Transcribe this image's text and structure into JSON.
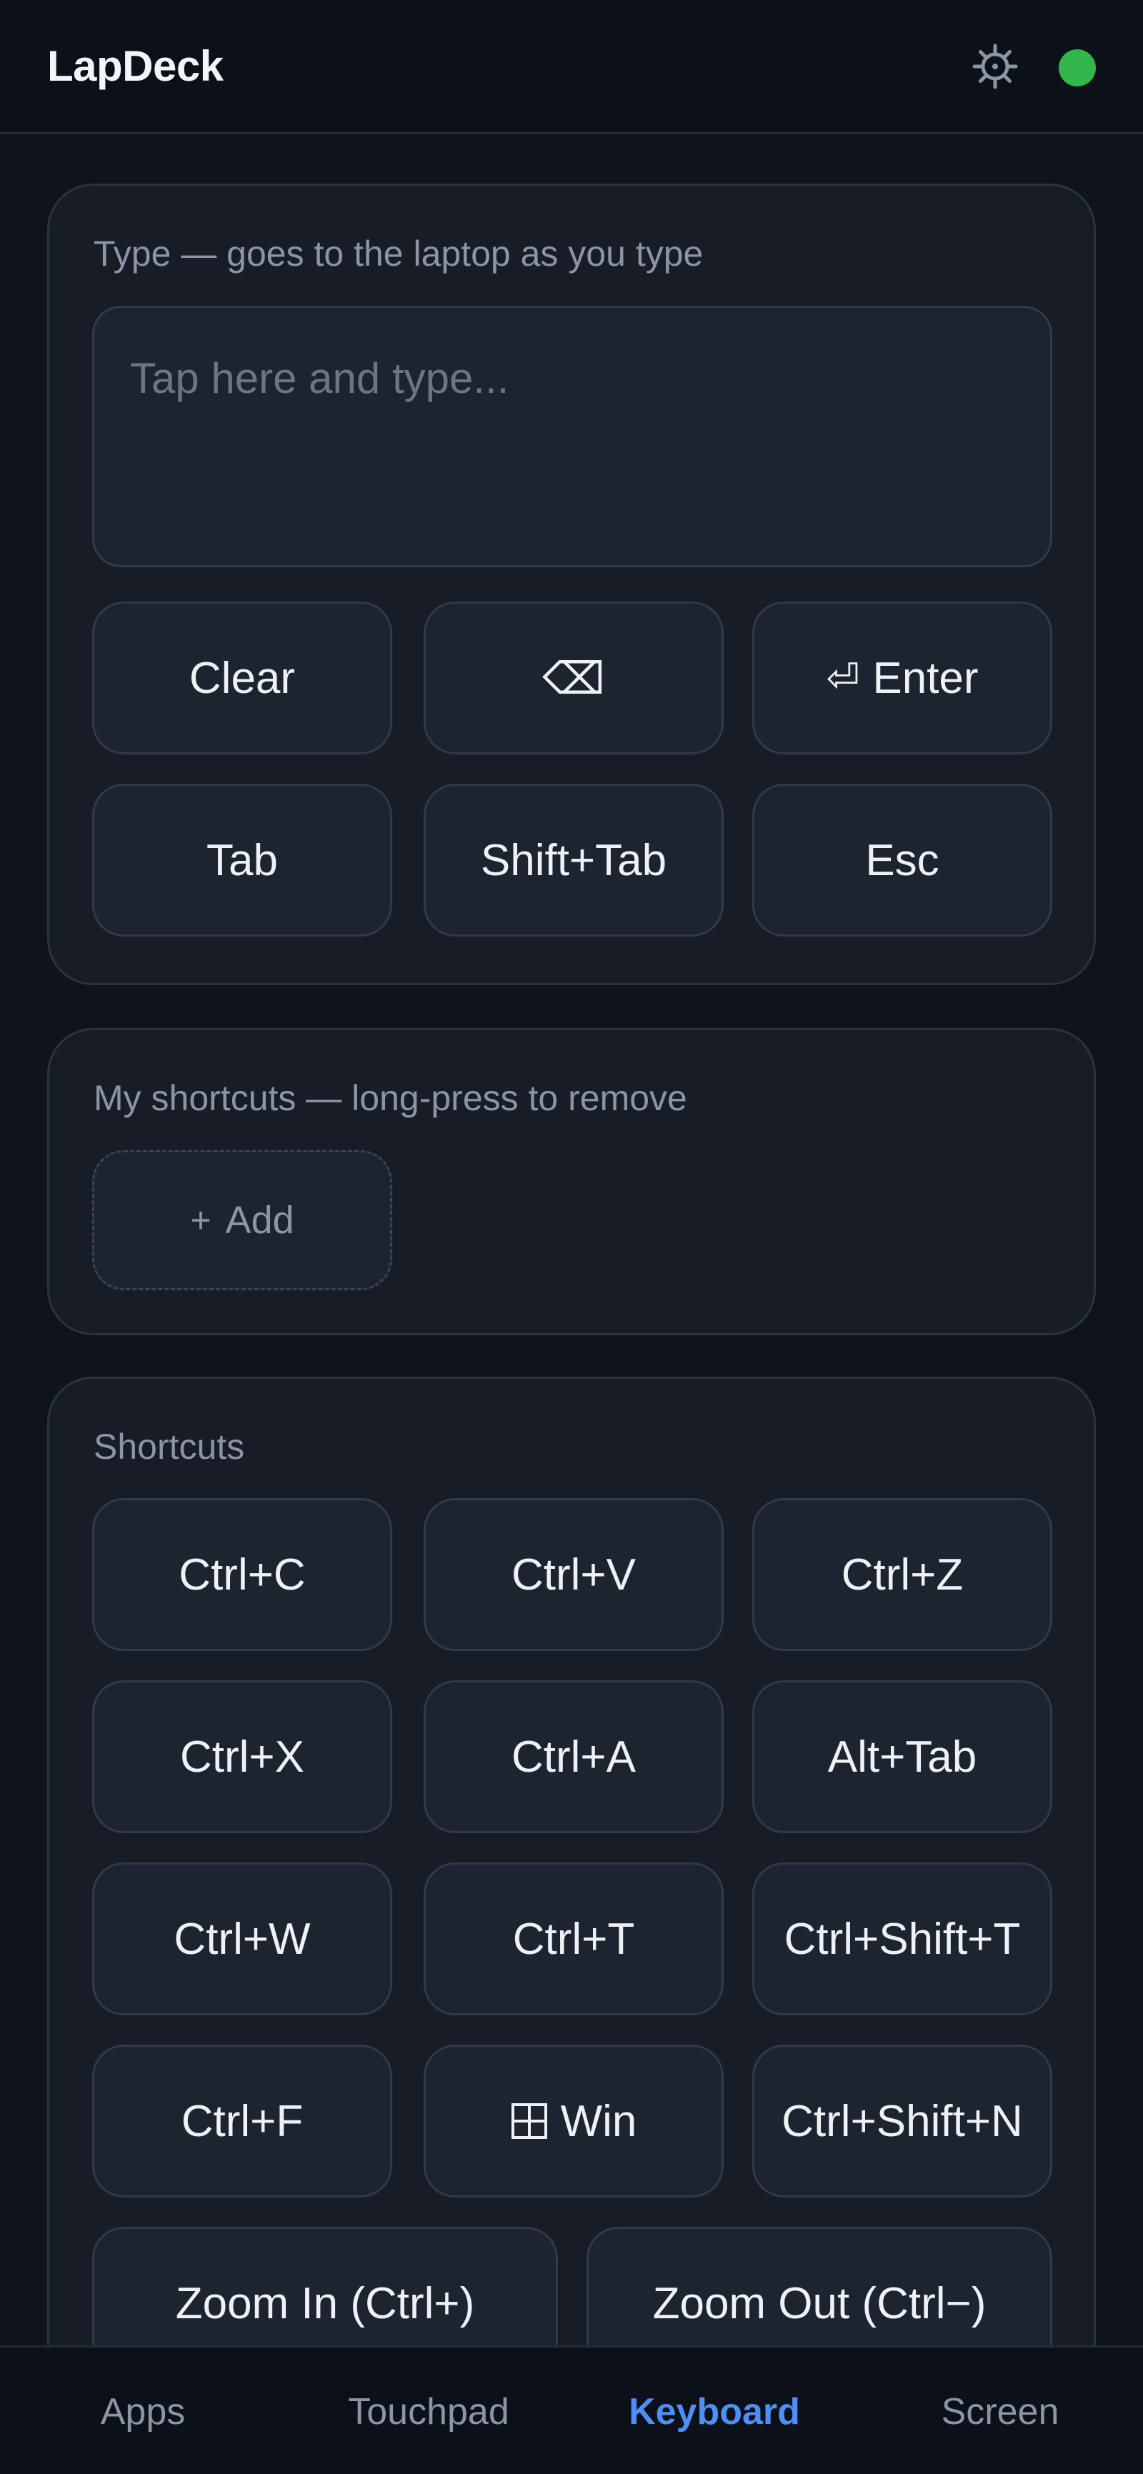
{
  "header": {
    "title": "LapDeck",
    "settings_icon": "gear-icon",
    "status": {
      "state": "connected",
      "color": "#33b74c"
    }
  },
  "type_card": {
    "caption": "Type — goes to the laptop as you type",
    "input": {
      "value": "",
      "placeholder": "Tap here and type..."
    },
    "keys": {
      "clear": "Clear",
      "backspace": "⌫",
      "enter": "Enter",
      "enter_icon": "⏎",
      "tab": "Tab",
      "shift_tab": "Shift+Tab",
      "esc": "Esc"
    }
  },
  "my_shortcuts": {
    "caption": "My shortcuts — long-press to remove",
    "add_icon": "+",
    "add_label": "Add"
  },
  "shortcuts": {
    "caption": "Shortcuts",
    "keys": [
      "Ctrl+C",
      "Ctrl+V",
      "Ctrl+Z",
      "Ctrl+X",
      "Ctrl+A",
      "Alt+Tab",
      "Ctrl+W",
      "Ctrl+T",
      "Ctrl+Shift+T",
      "Ctrl+F",
      "Win",
      "Ctrl+Shift+N"
    ],
    "win_icon": "windows-icon",
    "zoom_in": "Zoom In (Ctrl+)",
    "zoom_out": "Zoom Out (Ctrl−)"
  },
  "nav": {
    "tabs": [
      "Apps",
      "Touchpad",
      "Keyboard",
      "Screen"
    ],
    "active": "Keyboard",
    "accent": "#4d8ff5"
  }
}
